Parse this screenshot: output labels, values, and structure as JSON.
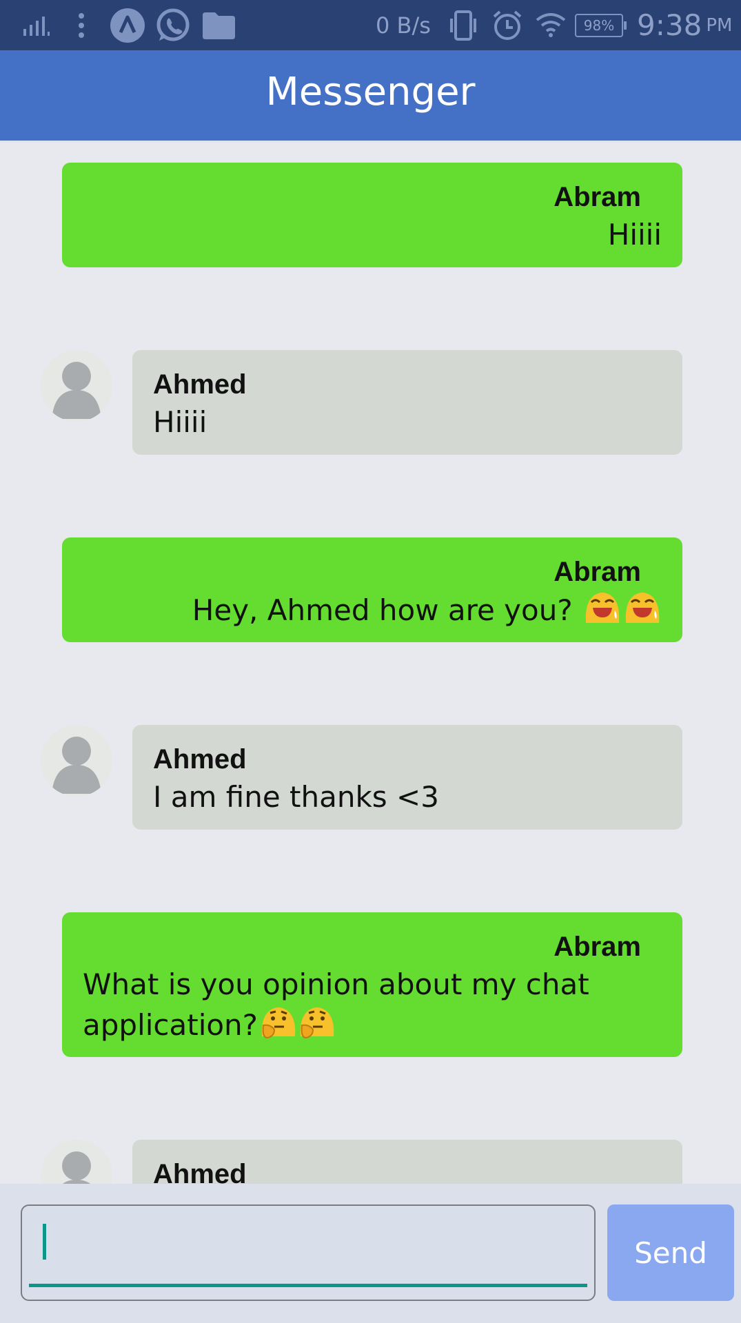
{
  "status_bar": {
    "network_speed": "0 B/s",
    "battery": "98%",
    "time": "9:38",
    "ampm": "PM"
  },
  "app": {
    "title": "Messenger"
  },
  "messages": [
    {
      "direction": "outgoing",
      "sender": "Abram",
      "text": "Hiiii",
      "emojis": []
    },
    {
      "direction": "incoming",
      "sender": "Ahmed",
      "text": "Hiiii",
      "emojis": []
    },
    {
      "direction": "outgoing",
      "sender": "Abram",
      "text": "Hey, Ahmed how are you?",
      "emojis": [
        "laughing-emoji",
        "laughing-emoji"
      ]
    },
    {
      "direction": "incoming",
      "sender": "Ahmed",
      "text": "I am fine thanks <3",
      "emojis": []
    },
    {
      "direction": "outgoing",
      "sender": "Abram",
      "text_line1": "What is you opinion about my chat",
      "text_line2": "application?",
      "emojis": [
        "thinking-emoji",
        "thinking-emoji"
      ]
    },
    {
      "direction": "incoming",
      "sender": "Ahmed",
      "text": "",
      "emojis": []
    }
  ],
  "composer": {
    "input_value": "",
    "send_label": "Send"
  },
  "colors": {
    "status_bar": "#2a4174",
    "app_bar": "#4470c6",
    "outgoing_bubble": "#64dc30",
    "incoming_bubble": "#d4d8d3",
    "background": "#e7e9ef",
    "send_button": "#8aa8f0",
    "accent": "#0d958a"
  }
}
